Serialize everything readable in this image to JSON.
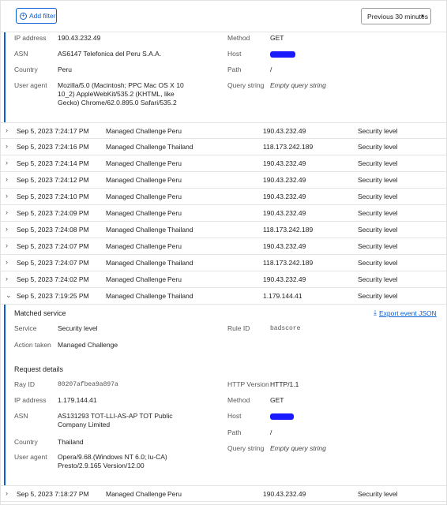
{
  "toolbar": {
    "add_filter_label": "Add filter",
    "time_range_label": "Previous 30 minutes"
  },
  "expanded_top": {
    "ip_address_key": "IP address",
    "ip_address": "190.43.232.49",
    "asn_key": "ASN",
    "asn": "AS6147 Telefonica del Peru S.A.A.",
    "country_key": "Country",
    "country": "Peru",
    "user_agent_key": "User agent",
    "user_agent_lines": [
      "Mozilla/5.0 (Macintosh; PPC Mac OS X 10",
      "10_2) AppleWebKit/535.2 (KHTML, like",
      "Gecko) Chrome/62.0.895.0 Safari/535.2"
    ],
    "method_key": "Method",
    "method": "GET",
    "host_key": "Host",
    "path_key": "Path",
    "path": "/",
    "query_key": "Query string",
    "query": "Empty query string"
  },
  "rows_top": [
    {
      "date": "Sep 5, 2023 7:24:17 PM",
      "action": "Managed Challenge",
      "country": "Peru",
      "ip": "190.43.232.49",
      "service": "Security level"
    },
    {
      "date": "Sep 5, 2023 7:24:16 PM",
      "action": "Managed Challenge",
      "country": "Thailand",
      "ip": "118.173.242.189",
      "service": "Security level"
    },
    {
      "date": "Sep 5, 2023 7:24:14 PM",
      "action": "Managed Challenge",
      "country": "Peru",
      "ip": "190.43.232.49",
      "service": "Security level"
    },
    {
      "date": "Sep 5, 2023 7:24:12 PM",
      "action": "Managed Challenge",
      "country": "Peru",
      "ip": "190.43.232.49",
      "service": "Security level"
    },
    {
      "date": "Sep 5, 2023 7:24:10 PM",
      "action": "Managed Challenge",
      "country": "Peru",
      "ip": "190.43.232.49",
      "service": "Security level"
    },
    {
      "date": "Sep 5, 2023 7:24:09 PM",
      "action": "Managed Challenge",
      "country": "Peru",
      "ip": "190.43.232.49",
      "service": "Security level"
    },
    {
      "date": "Sep 5, 2023 7:24:08 PM",
      "action": "Managed Challenge",
      "country": "Thailand",
      "ip": "118.173.242.189",
      "service": "Security level"
    },
    {
      "date": "Sep 5, 2023 7:24:07 PM",
      "action": "Managed Challenge",
      "country": "Peru",
      "ip": "190.43.232.49",
      "service": "Security level"
    },
    {
      "date": "Sep 5, 2023 7:24:07 PM",
      "action": "Managed Challenge",
      "country": "Thailand",
      "ip": "118.173.242.189",
      "service": "Security level"
    },
    {
      "date": "Sep 5, 2023 7:24:02 PM",
      "action": "Managed Challenge",
      "country": "Peru",
      "ip": "190.43.232.49",
      "service": "Security level"
    },
    {
      "date": "Sep 5, 2023 7:19:25 PM",
      "action": "Managed Challenge",
      "country": "Thailand",
      "ip": "1.179.144.41",
      "service": "Security level"
    }
  ],
  "matched_service": {
    "title": "Matched service",
    "service_key": "Service",
    "service": "Security level",
    "action_key": "Action taken",
    "action": "Managed Challenge",
    "rule_key": "Rule ID",
    "rule": "badscore",
    "export_label": "Export event JSON"
  },
  "request_details": {
    "title": "Request details",
    "ray_key": "Ray ID",
    "ray": "80207afbea9a897a",
    "ip_key": "IP address",
    "ip": "1.179.144.41",
    "asn_key": "ASN",
    "asn_lines": [
      "AS131293 TOT-LLI-AS-AP TOT Public",
      "Company Limited"
    ],
    "country_key": "Country",
    "country": "Thailand",
    "user_agent_key": "User agent",
    "user_agent_lines": [
      "Opera/9.68.(Windows NT 6.0; lu-CA)",
      "Presto/2.9.165 Version/12.00"
    ],
    "http_key": "HTTP Version",
    "http": "HTTP/1.1",
    "method_key": "Method",
    "method": "GET",
    "host_key": "Host",
    "path_key": "Path",
    "path": "/",
    "query_key": "Query string",
    "query": "Empty query string"
  },
  "row_bottom": {
    "date": "Sep 5, 2023 7:18:27 PM",
    "action": "Managed Challenge",
    "country": "Peru",
    "ip": "190.43.232.49",
    "service": "Security level"
  },
  "colors": {
    "accent": "#0a5fd6",
    "redaction": "#1a1aff"
  },
  "icons": {
    "add": "plus-circle-icon",
    "dropdown": "chevron-down-icon",
    "row_collapsed": "chevron-right-icon",
    "row_expanded": "chevron-down-icon",
    "export": "download-icon"
  }
}
